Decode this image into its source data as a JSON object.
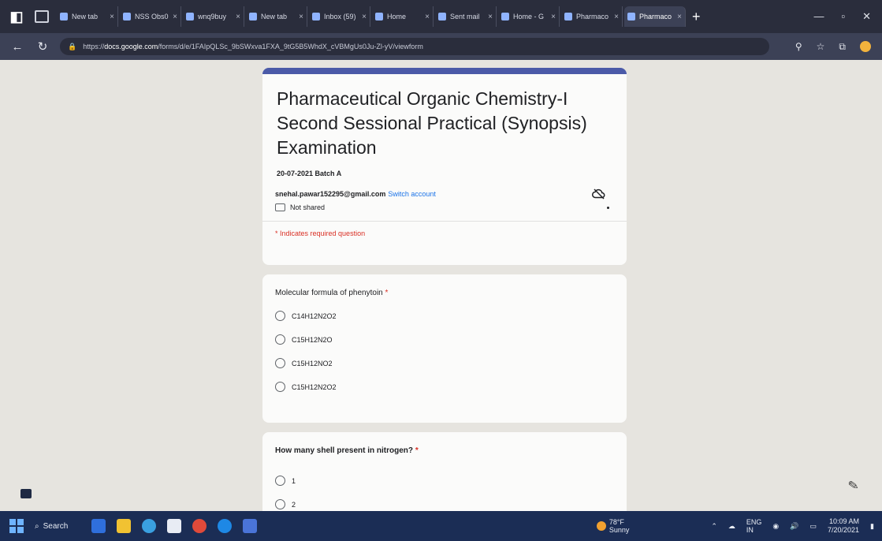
{
  "browser": {
    "tabs": [
      {
        "label": "New tab"
      },
      {
        "label": "NSS Obs0"
      },
      {
        "label": "wnq9buy"
      },
      {
        "label": "New tab"
      },
      {
        "label": "Inbox (59)"
      },
      {
        "label": "Home"
      },
      {
        "label": "Sent mail"
      },
      {
        "label": "Home - G"
      },
      {
        "label": "Pharmaco"
      },
      {
        "label": "Pharmaco",
        "active": true
      }
    ],
    "url_prefix": "https://",
    "url_domain": "docs.google.com",
    "url_rest": "/forms/d/e/1FAIpQLSc_9bSWxva1FXA_9tG5B5WhdX_cVBMgUs0Ju-Zl-yV/viewform"
  },
  "form": {
    "title": "Pharmaceutical Organic Chemistry-I Second Sessional Practical (Synopsis) Examination",
    "description": "20-07-2021 Batch A",
    "email": "snehal.pawar152295@gmail.com",
    "switch_account": "Switch account",
    "not_shared": "Not shared",
    "required_note": "* Indicates required question",
    "questions": [
      {
        "title": "Molecular formula of phenytoin",
        "required_mark": "*",
        "options": [
          "C14H12N2O2",
          "C15H12N2O",
          "C15H12NO2",
          "C15H12N2O2"
        ]
      },
      {
        "title": "How many shell present in nitrogen?",
        "required_mark": "*",
        "options": [
          "1",
          "2"
        ]
      }
    ]
  },
  "taskbar": {
    "search_label": "Search",
    "weather_temp": "78°F",
    "weather_desc": "Sunny",
    "lang": "ENG",
    "lang2": "IN",
    "time": "10:09 AM",
    "date": "7/20/2021"
  },
  "icons": {
    "cloud": "cloud-off-icon",
    "shared": "not-shared-icon"
  }
}
